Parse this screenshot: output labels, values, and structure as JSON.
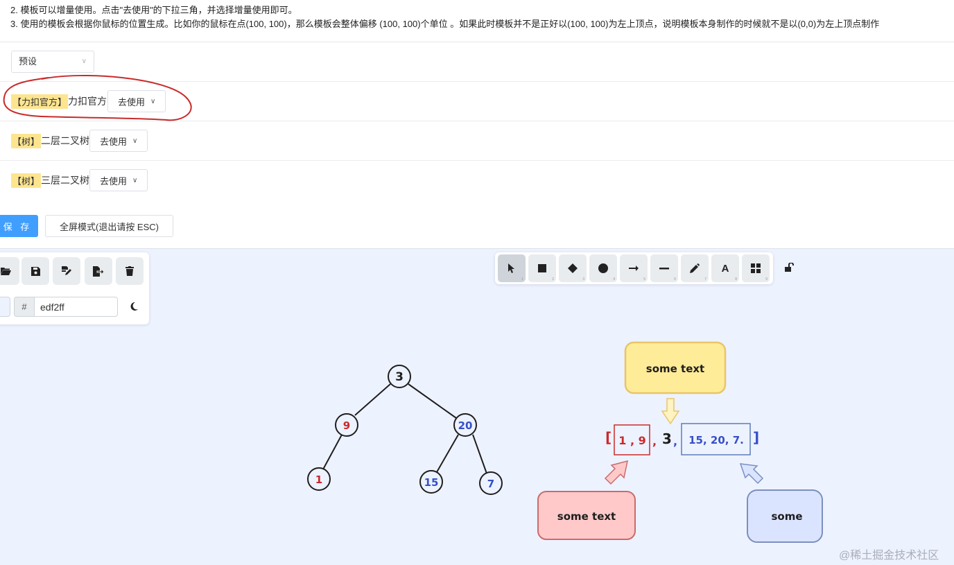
{
  "notes": {
    "line2": "2. 模板可以增量使用。点击\"去使用\"的下拉三角，并选择增量使用即可。",
    "line3": "3. 使用的模板会根据你鼠标的位置生成。比如你的鼠标在点(100, 100)，那么模板会整体偏移 (100, 100)个单位 。如果此时模板并不是正好以(100, 100)为左上顶点，说明模板本身制作的时候就不是以(0,0)为左上顶点制作"
  },
  "preset": {
    "selected": "预设"
  },
  "templates": [
    {
      "tag": "【力扣官方】",
      "name": "力扣官方",
      "button": "去使用"
    },
    {
      "tag": "【树】",
      "name": "二层二叉树",
      "button": "去使用"
    },
    {
      "tag": "【树】",
      "name": "三层二叉树",
      "button": "去使用"
    }
  ],
  "actions": {
    "save": "保 存",
    "fullscreen": "全屏模式(退出请按 ESC)"
  },
  "color_panel": {
    "hash": "#",
    "value": "edf2ff"
  },
  "left_tools": [
    "open-folder-icon",
    "save-icon",
    "save-as-icon",
    "export-icon",
    "trash-icon"
  ],
  "toolbar": {
    "tools": [
      {
        "icon": "pointer-icon",
        "num": "1"
      },
      {
        "icon": "rectangle-icon",
        "num": "2"
      },
      {
        "icon": "diamond-icon",
        "num": "3"
      },
      {
        "icon": "ellipse-icon",
        "num": "4"
      },
      {
        "icon": "arrow-icon",
        "num": "5"
      },
      {
        "icon": "line-icon",
        "num": "6"
      },
      {
        "icon": "pencil-icon",
        "num": "7"
      },
      {
        "icon": "text-icon",
        "num": "8"
      },
      {
        "icon": "library-icon",
        "num": "9"
      }
    ],
    "lock": "unlock-icon"
  },
  "tree": {
    "nodes": [
      "3",
      "9",
      "20",
      "1",
      "15",
      "7"
    ]
  },
  "array_diagram": {
    "open": "[",
    "left_part": "1 , 9",
    "middle": "3",
    "right_part": "15, 20, 7.",
    "close": "]",
    "sep1": ",",
    "sep2": ",",
    "top_label": "some text",
    "left_label": "some text",
    "right_label": "some"
  },
  "watermark": "@稀土掘金技术社区",
  "colors": {
    "primary": "#409eff",
    "canvas": "#edf2ff",
    "tag": "#fde58f",
    "circle": "#c92a2a",
    "yellow": "#ffec99",
    "red": "#ffc9c9",
    "blue": "#dbe4ff"
  }
}
